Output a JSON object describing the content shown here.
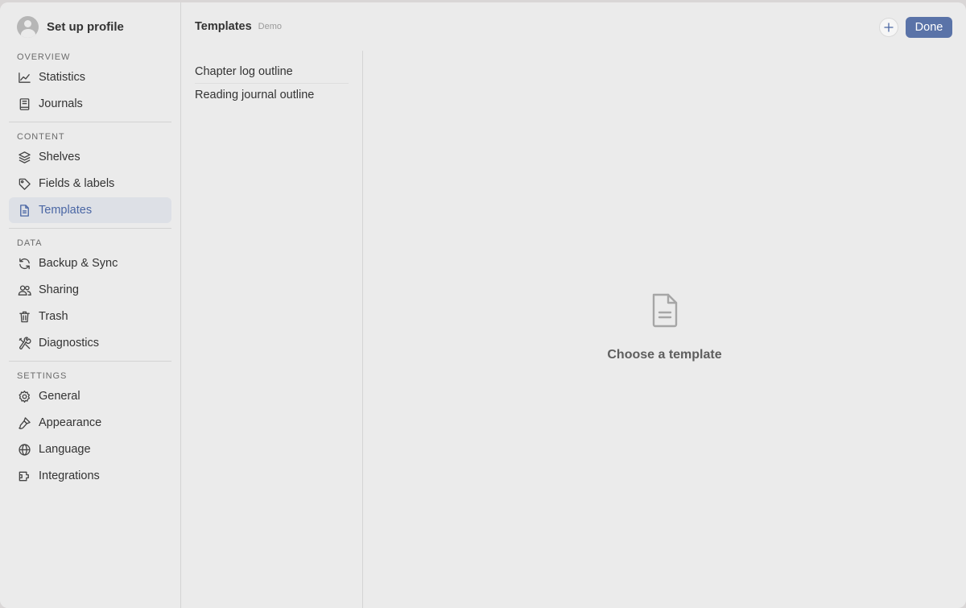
{
  "sidebar": {
    "profile_label": "Set up profile",
    "sections": [
      {
        "title": "OVERVIEW",
        "items": [
          {
            "label": "Statistics",
            "icon": "chart-line-icon"
          },
          {
            "label": "Journals",
            "icon": "book-icon"
          }
        ]
      },
      {
        "title": "CONTENT",
        "items": [
          {
            "label": "Shelves",
            "icon": "layers-icon"
          },
          {
            "label": "Fields & labels",
            "icon": "tag-icon"
          },
          {
            "label": "Templates",
            "icon": "document-icon",
            "active": true
          }
        ]
      },
      {
        "title": "DATA",
        "items": [
          {
            "label": "Backup & Sync",
            "icon": "sync-icon"
          },
          {
            "label": "Sharing",
            "icon": "people-icon"
          },
          {
            "label": "Trash",
            "icon": "trash-icon"
          },
          {
            "label": "Diagnostics",
            "icon": "tools-icon"
          }
        ]
      },
      {
        "title": "SETTINGS",
        "items": [
          {
            "label": "General",
            "icon": "gear-icon"
          },
          {
            "label": "Appearance",
            "icon": "brush-icon"
          },
          {
            "label": "Language",
            "icon": "globe-icon"
          },
          {
            "label": "Integrations",
            "icon": "plug-icon"
          }
        ]
      }
    ]
  },
  "header": {
    "title": "Templates",
    "badge": "Demo",
    "add_icon": "plus-icon",
    "done_label": "Done"
  },
  "templates_list": [
    "Chapter log outline",
    "Reading journal outline"
  ],
  "empty_state": {
    "icon": "document-icon",
    "label": "Choose a template"
  },
  "colors": {
    "accent": "#5a73a8",
    "active_bg": "#dde0e6",
    "active_text": "#4a66a4",
    "window_bg": "#ebebeb"
  }
}
